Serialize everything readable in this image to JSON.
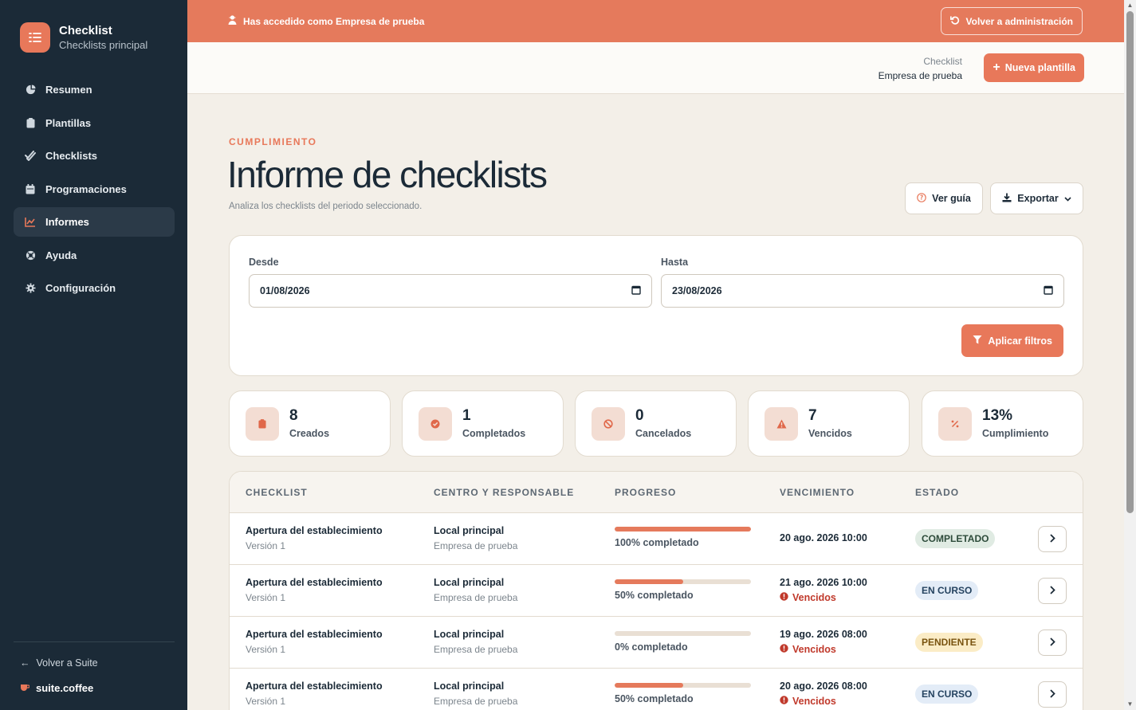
{
  "sidebar": {
    "brand_title": "Checklist",
    "brand_subtitle": "Checklists principal",
    "items": [
      {
        "label": "Resumen",
        "icon": "pie-chart-icon"
      },
      {
        "label": "Plantillas",
        "icon": "clipboard-icon"
      },
      {
        "label": "Checklists",
        "icon": "check-double-icon"
      },
      {
        "label": "Programaciones",
        "icon": "calendar-icon"
      },
      {
        "label": "Informes",
        "icon": "chart-line-icon",
        "active": true
      },
      {
        "label": "Ayuda",
        "icon": "lifebuoy-icon"
      },
      {
        "label": "Configuración",
        "icon": "gear-icon"
      }
    ],
    "back_label": "Volver a Suite",
    "suite_label": "suite.coffee"
  },
  "banner": {
    "text": "Has accedido como Empresa de prueba",
    "button": "Volver a administración"
  },
  "header": {
    "context_line1": "Checklist",
    "context_line2": "Empresa de prueba",
    "new_button": "Nueva plantilla"
  },
  "page": {
    "eyebrow": "CUMPLIMIENTO",
    "title": "Informe de checklists",
    "subtitle": "Analiza los checklists del periodo seleccionado.",
    "guide_button": "Ver guía",
    "export_button": "Exportar"
  },
  "filters": {
    "from_label": "Desde",
    "from_value": "01/08/2026",
    "to_label": "Hasta",
    "to_value": "23/08/2026",
    "apply_button": "Aplicar filtros"
  },
  "stats": [
    {
      "value": "8",
      "label": "Creados",
      "icon": "clipboard-icon"
    },
    {
      "value": "1",
      "label": "Completados",
      "icon": "check-circle-icon"
    },
    {
      "value": "0",
      "label": "Cancelados",
      "icon": "ban-icon"
    },
    {
      "value": "7",
      "label": "Vencidos",
      "icon": "warning-icon"
    },
    {
      "value": "13%",
      "label": "Cumplimiento",
      "icon": "percent-icon"
    }
  ],
  "table": {
    "headers": [
      "CHECKLIST",
      "CENTRO Y RESPONSABLE",
      "PROGRESO",
      "VENCIMIENTO",
      "ESTADO"
    ],
    "rows": [
      {
        "title": "Apertura del establecimiento",
        "version": "Versión 1",
        "center": "Local principal",
        "owner": "Empresa de prueba",
        "progress": 100,
        "progress_text": "100% completado",
        "due": "20 ago. 2026 10:00",
        "overdue": "",
        "status": "COMPLETADO",
        "status_kind": "done"
      },
      {
        "title": "Apertura del establecimiento",
        "version": "Versión 1",
        "center": "Local principal",
        "owner": "Empresa de prueba",
        "progress": 50,
        "progress_text": "50% completado",
        "due": "21 ago. 2026 10:00",
        "overdue": "Vencidos",
        "status": "EN CURSO",
        "status_kind": "progress"
      },
      {
        "title": "Apertura del establecimiento",
        "version": "Versión 1",
        "center": "Local principal",
        "owner": "Empresa de prueba",
        "progress": 0,
        "progress_text": "0% completado",
        "due": "19 ago. 2026 08:00",
        "overdue": "Vencidos",
        "status": "PENDIENTE",
        "status_kind": "pending"
      },
      {
        "title": "Apertura del establecimiento",
        "version": "Versión 1",
        "center": "Local principal",
        "owner": "Empresa de prueba",
        "progress": 50,
        "progress_text": "50% completado",
        "due": "20 ago. 2026 08:00",
        "overdue": "Vencidos",
        "status": "EN CURSO",
        "status_kind": "progress"
      }
    ]
  },
  "colors": {
    "accent": "#e8785a",
    "sidebar": "#1b2a37",
    "background": "#f3efe8"
  }
}
